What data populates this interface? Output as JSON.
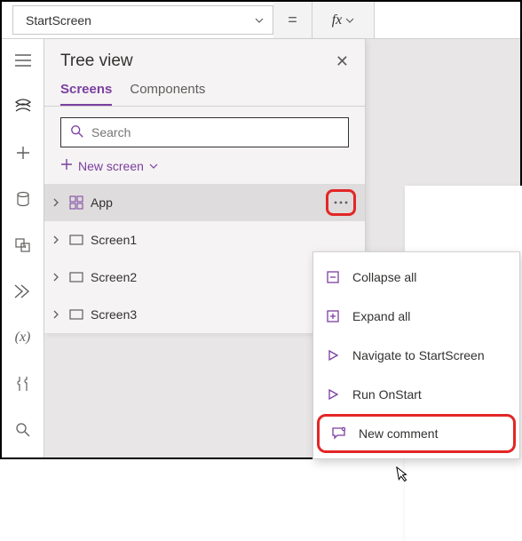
{
  "formula": {
    "property": "StartScreen",
    "equals": "=",
    "fx": "fx"
  },
  "treeview": {
    "title": "Tree view",
    "tabs": {
      "screens": "Screens",
      "components": "Components"
    },
    "search_placeholder": "Search",
    "new_screen": "New screen",
    "items": [
      {
        "label": "App",
        "type": "app"
      },
      {
        "label": "Screen1",
        "type": "screen"
      },
      {
        "label": "Screen2",
        "type": "screen"
      },
      {
        "label": "Screen3",
        "type": "screen"
      }
    ]
  },
  "context_menu": {
    "collapse_all": "Collapse all",
    "expand_all": "Expand all",
    "navigate": "Navigate to StartScreen",
    "run_onstart": "Run OnStart",
    "new_comment": "New comment"
  }
}
